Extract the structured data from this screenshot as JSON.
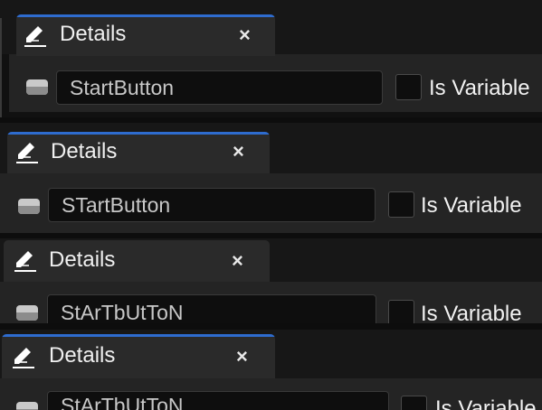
{
  "panels": [
    {
      "tab": {
        "title": "Details",
        "close_glyph": "×",
        "icon": "pencil-icon"
      },
      "widget": {
        "icon": "widget-icon",
        "name": "StartButton",
        "is_variable_label": "Is Variable"
      }
    },
    {
      "tab": {
        "title": "Details",
        "close_glyph": "×",
        "icon": "pencil-icon"
      },
      "widget": {
        "icon": "widget-icon",
        "name": "STartButton",
        "is_variable_label": "Is Variable"
      }
    },
    {
      "tab": {
        "title": "Details",
        "close_glyph": "×",
        "icon": "pencil-icon"
      },
      "widget": {
        "icon": "widget-icon",
        "name": "StArTbUtToN",
        "is_variable_label": "Is Variable"
      }
    },
    {
      "tab": {
        "title": "Details",
        "close_glyph": "×",
        "icon": "pencil-icon"
      },
      "widget": {
        "icon": "widget-icon",
        "name": "StArTbUtToN",
        "is_variable_label": "Is Variable"
      }
    }
  ],
  "colors": {
    "accent": "#2e6ccf",
    "panel_bg": "#242424",
    "tab_bg": "#2a2a2a",
    "field_bg": "#0e0e0e"
  }
}
